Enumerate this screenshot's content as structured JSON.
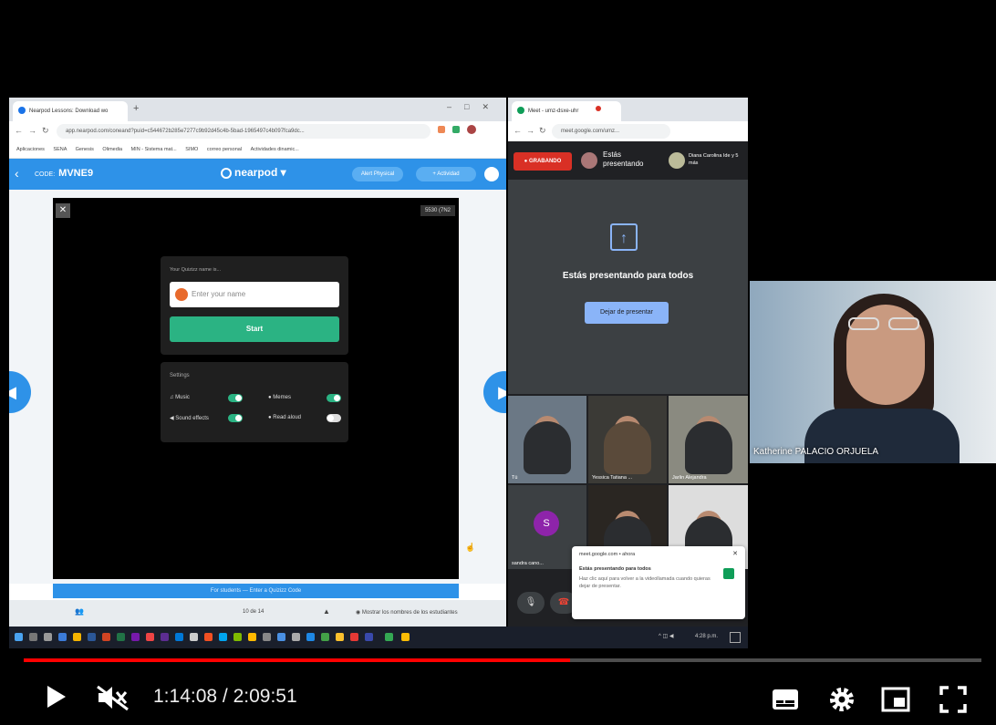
{
  "browser_left": {
    "tab_title": "Nearpod Lessons: Download wo",
    "url": "app.nearpod.com/coneand?puid=c544672b285e7277c9b92d45c4b-5bad-1965497c4b097fca9dc...",
    "bookmarks": [
      "Aplicaciones",
      "SENA",
      "Genesis",
      "Olimedia",
      "MIN - Sistema mat...",
      "SIMO",
      "correo personal",
      "Actividades dinamic..."
    ],
    "nearpod": {
      "code_label": "CODE:",
      "code": "MVNE9",
      "logo": "nearpod",
      "user_pill": "Alert Physical",
      "activity_pill": "+ Actividad",
      "counter": "5530 (7N2",
      "name_prompt": "Your Quizizz name is...",
      "name_placeholder": "Enter your name",
      "start_label": "Start",
      "settings_title": "Settings",
      "settings": {
        "music": "Music",
        "memes": "Memes",
        "sound_effects": "Sound effects",
        "read_aloud": "Read aloud"
      },
      "footer": "For students — Enter a Quizizz Code",
      "slide_position": "10 de 14",
      "show_names": "Mostrar los nombres de los estudiantes"
    }
  },
  "browser_right": {
    "tab_title": "Meet - umz-dsxe-uhr",
    "url": "meet.google.com/umz...",
    "recording_label": "GRABANDO",
    "presenting_label": "Estás presentando",
    "participants_label": "Diana Carolina Ide y 5 más",
    "presenting_to_all": "Estás presentando para todos",
    "stop_presenting": "Dejar de presentar",
    "tiles": [
      {
        "name": "Tú"
      },
      {
        "name": "Yessica Tatiana ..."
      },
      {
        "name": "Jarlin Alejandra"
      },
      {
        "name": "sandra cano..."
      },
      {
        "name": ""
      },
      {
        "name": ""
      }
    ],
    "tile_initial": "S",
    "popup": {
      "source": "meet.google.com • ahora",
      "title": "Estás presentando para todos",
      "body": "Haz clic aquí para volver a la videollamada cuando quieras dejar de presentar."
    }
  },
  "taskbar": {
    "time": "4:28 p.m."
  },
  "webcam": {
    "name": "Katherine PALACIO ORJUELA"
  },
  "player": {
    "time_display": "1:14:08 / 2:09:51",
    "progress_fraction": 0.57,
    "colors": {
      "progress": "#ff0000",
      "accent": "#2e92e8",
      "recording": "#d93025"
    }
  }
}
